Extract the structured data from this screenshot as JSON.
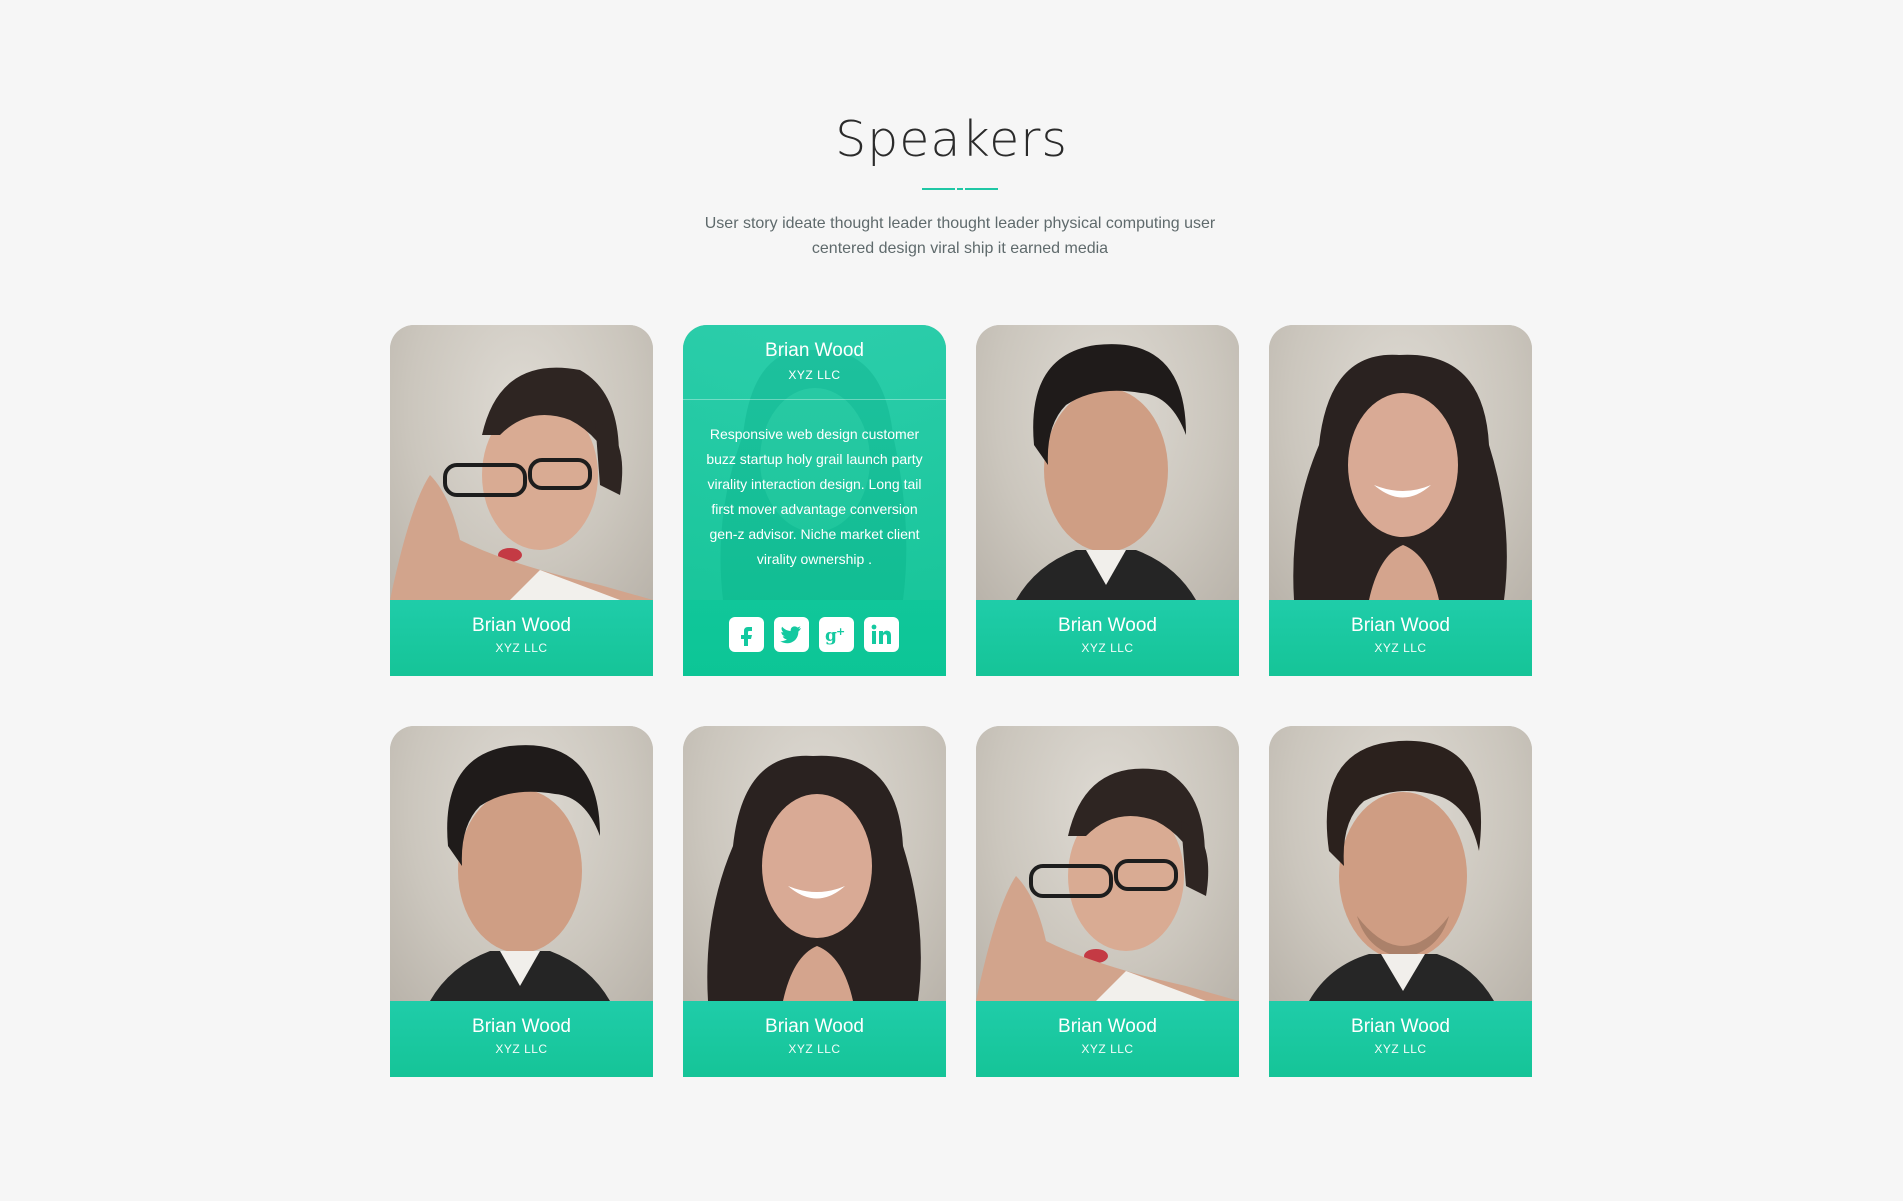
{
  "section": {
    "title": "Speakers",
    "subtitle_line1": "User story ideate thought leader thought leader physical computing user",
    "subtitle_line2": "centered design viral ship it earned media",
    "accent_color": "#1fc7a5"
  },
  "speakers": [
    {
      "name": "Brian Wood",
      "company": "XYZ LLC",
      "photo": "woman-with-glasses"
    },
    {
      "name": "Brian Wood",
      "company": "XYZ LLC",
      "photo": "woman-smiling",
      "active": true,
      "bio": "Responsive web design customer buzz startup holy grail launch party virality interaction design. Long tail first mover advantage conversion gen-z advisor. Niche market client virality ownership .",
      "socials": [
        "facebook-icon",
        "twitter-icon",
        "google-plus-icon",
        "linkedin-icon"
      ]
    },
    {
      "name": "Brian Wood",
      "company": "XYZ LLC",
      "photo": "man-dark-hair"
    },
    {
      "name": "Brian Wood",
      "company": "XYZ LLC",
      "photo": "woman-smiling"
    },
    {
      "name": "Brian Wood",
      "company": "XYZ LLC",
      "photo": "man-dark-hair"
    },
    {
      "name": "Brian Wood",
      "company": "XYZ LLC",
      "photo": "woman-smiling"
    },
    {
      "name": "Brian Wood",
      "company": "XYZ LLC",
      "photo": "woman-with-glasses"
    },
    {
      "name": "Brian Wood",
      "company": "XYZ LLC",
      "photo": "man-beard"
    }
  ]
}
